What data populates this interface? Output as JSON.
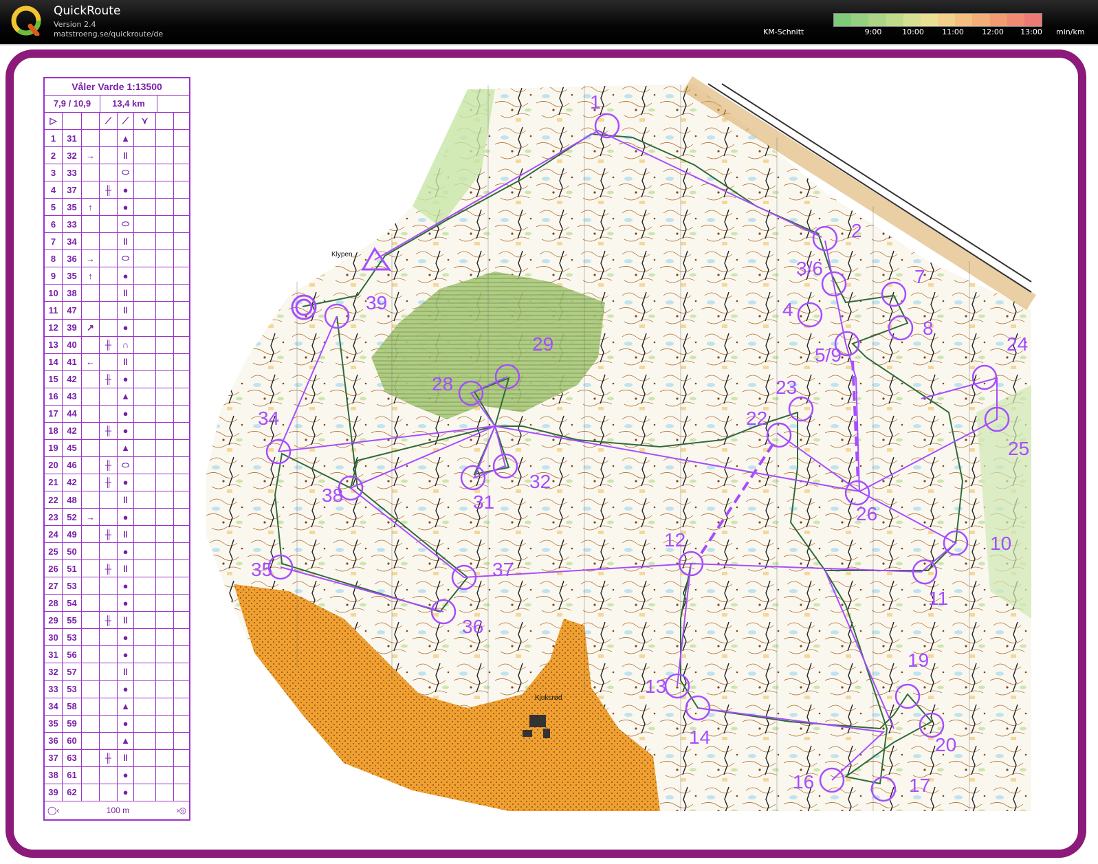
{
  "app": {
    "title": "QuickRoute",
    "version": "Version 2.4",
    "url": "matstroeng.se/quickroute/de"
  },
  "speed_legend": {
    "label": "KM-Schnitt",
    "ticks": [
      "9:00",
      "10:00",
      "11:00",
      "12:00",
      "13:00"
    ],
    "unit": "min/km",
    "colors": [
      "#7fc97a",
      "#95cf80",
      "#abd486",
      "#c0da8c",
      "#d5df92",
      "#e8df94",
      "#f0d08a",
      "#f2bf80",
      "#f3ae78",
      "#f39c73",
      "#f08a72",
      "#ec7a74"
    ]
  },
  "frame_color": "#8b1a7a",
  "course_color": "#a64dff",
  "route_color": "#2f6b3a",
  "map": {
    "place_labels": [
      "Klypen",
      "Kjuksrød"
    ],
    "controls": [
      {
        "label": "1"
      },
      {
        "label": "2"
      },
      {
        "label": "3/6"
      },
      {
        "label": "4"
      },
      {
        "label": "5/9"
      },
      {
        "label": "7"
      },
      {
        "label": "8"
      },
      {
        "label": "10"
      },
      {
        "label": "11"
      },
      {
        "label": "12"
      },
      {
        "label": "13"
      },
      {
        "label": "14"
      },
      {
        "label": "16"
      },
      {
        "label": "17"
      },
      {
        "label": "19"
      },
      {
        "label": "20"
      },
      {
        "label": "22"
      },
      {
        "label": "23"
      },
      {
        "label": "24"
      },
      {
        "label": "25"
      },
      {
        "label": "26"
      },
      {
        "label": "28"
      },
      {
        "label": "29"
      },
      {
        "label": "31"
      },
      {
        "label": "32"
      },
      {
        "label": "34"
      },
      {
        "label": "35"
      },
      {
        "label": "36"
      },
      {
        "label": "37"
      },
      {
        "label": "38"
      },
      {
        "label": "39"
      }
    ]
  },
  "description": {
    "title": "Våler Varde 1:13500",
    "course_stats": "7,9 / 10,9",
    "length": "13,4 km",
    "rows": [
      {
        "n": "1",
        "code": "31",
        "dir": "",
        "feat": "",
        "sym": "▲"
      },
      {
        "n": "2",
        "code": "32",
        "dir": "→",
        "feat": "",
        "sym": "ǁ"
      },
      {
        "n": "3",
        "code": "33",
        "dir": "",
        "feat": "",
        "sym": "⬭"
      },
      {
        "n": "4",
        "code": "37",
        "dir": "",
        "feat": "╫",
        "sym": "●"
      },
      {
        "n": "5",
        "code": "35",
        "dir": "↑",
        "feat": "",
        "sym": "●"
      },
      {
        "n": "6",
        "code": "33",
        "dir": "",
        "feat": "",
        "sym": "⬭"
      },
      {
        "n": "7",
        "code": "34",
        "dir": "",
        "feat": "",
        "sym": "ǁ"
      },
      {
        "n": "8",
        "code": "36",
        "dir": "→",
        "feat": "",
        "sym": "⬭"
      },
      {
        "n": "9",
        "code": "35",
        "dir": "↑",
        "feat": "",
        "sym": "●"
      },
      {
        "n": "10",
        "code": "38",
        "dir": "",
        "feat": "",
        "sym": "ǁ"
      },
      {
        "n": "11",
        "code": "47",
        "dir": "",
        "feat": "",
        "sym": "ǁ"
      },
      {
        "n": "12",
        "code": "39",
        "dir": "↗",
        "feat": "",
        "sym": "●"
      },
      {
        "n": "13",
        "code": "40",
        "dir": "",
        "feat": "╫",
        "sym": "∩"
      },
      {
        "n": "14",
        "code": "41",
        "dir": "←",
        "feat": "",
        "sym": "ǁ"
      },
      {
        "n": "15",
        "code": "42",
        "dir": "",
        "feat": "╫",
        "sym": "●"
      },
      {
        "n": "16",
        "code": "43",
        "dir": "",
        "feat": "",
        "sym": "▲"
      },
      {
        "n": "17",
        "code": "44",
        "dir": "",
        "feat": "",
        "sym": "●"
      },
      {
        "n": "18",
        "code": "42",
        "dir": "",
        "feat": "╫",
        "sym": "●"
      },
      {
        "n": "19",
        "code": "45",
        "dir": "",
        "feat": "",
        "sym": "▲"
      },
      {
        "n": "20",
        "code": "46",
        "dir": "",
        "feat": "╫",
        "sym": "⬭"
      },
      {
        "n": "21",
        "code": "42",
        "dir": "",
        "feat": "╫",
        "sym": "●"
      },
      {
        "n": "22",
        "code": "48",
        "dir": "",
        "feat": "",
        "sym": "ǁ"
      },
      {
        "n": "23",
        "code": "52",
        "dir": "→",
        "feat": "",
        "sym": "●"
      },
      {
        "n": "24",
        "code": "49",
        "dir": "",
        "feat": "╫",
        "sym": "ǁ"
      },
      {
        "n": "25",
        "code": "50",
        "dir": "",
        "feat": "",
        "sym": "●"
      },
      {
        "n": "26",
        "code": "51",
        "dir": "",
        "feat": "╫",
        "sym": "ǁ"
      },
      {
        "n": "27",
        "code": "53",
        "dir": "",
        "feat": "",
        "sym": "●"
      },
      {
        "n": "28",
        "code": "54",
        "dir": "",
        "feat": "",
        "sym": "●"
      },
      {
        "n": "29",
        "code": "55",
        "dir": "",
        "feat": "╫",
        "sym": "ǁ"
      },
      {
        "n": "30",
        "code": "53",
        "dir": "",
        "feat": "",
        "sym": "●"
      },
      {
        "n": "31",
        "code": "56",
        "dir": "",
        "feat": "",
        "sym": "●"
      },
      {
        "n": "32",
        "code": "57",
        "dir": "",
        "feat": "",
        "sym": "ǁ"
      },
      {
        "n": "33",
        "code": "53",
        "dir": "",
        "feat": "",
        "sym": "●"
      },
      {
        "n": "34",
        "code": "58",
        "dir": "",
        "feat": "",
        "sym": "▲"
      },
      {
        "n": "35",
        "code": "59",
        "dir": "",
        "feat": "",
        "sym": "●"
      },
      {
        "n": "36",
        "code": "60",
        "dir": "",
        "feat": "",
        "sym": "▲"
      },
      {
        "n": "37",
        "code": "63",
        "dir": "",
        "feat": "╫",
        "sym": "ǁ"
      },
      {
        "n": "38",
        "code": "61",
        "dir": "",
        "feat": "",
        "sym": "●"
      },
      {
        "n": "39",
        "code": "62",
        "dir": "",
        "feat": "",
        "sym": "●"
      }
    ],
    "finish_distance": "100 m"
  }
}
